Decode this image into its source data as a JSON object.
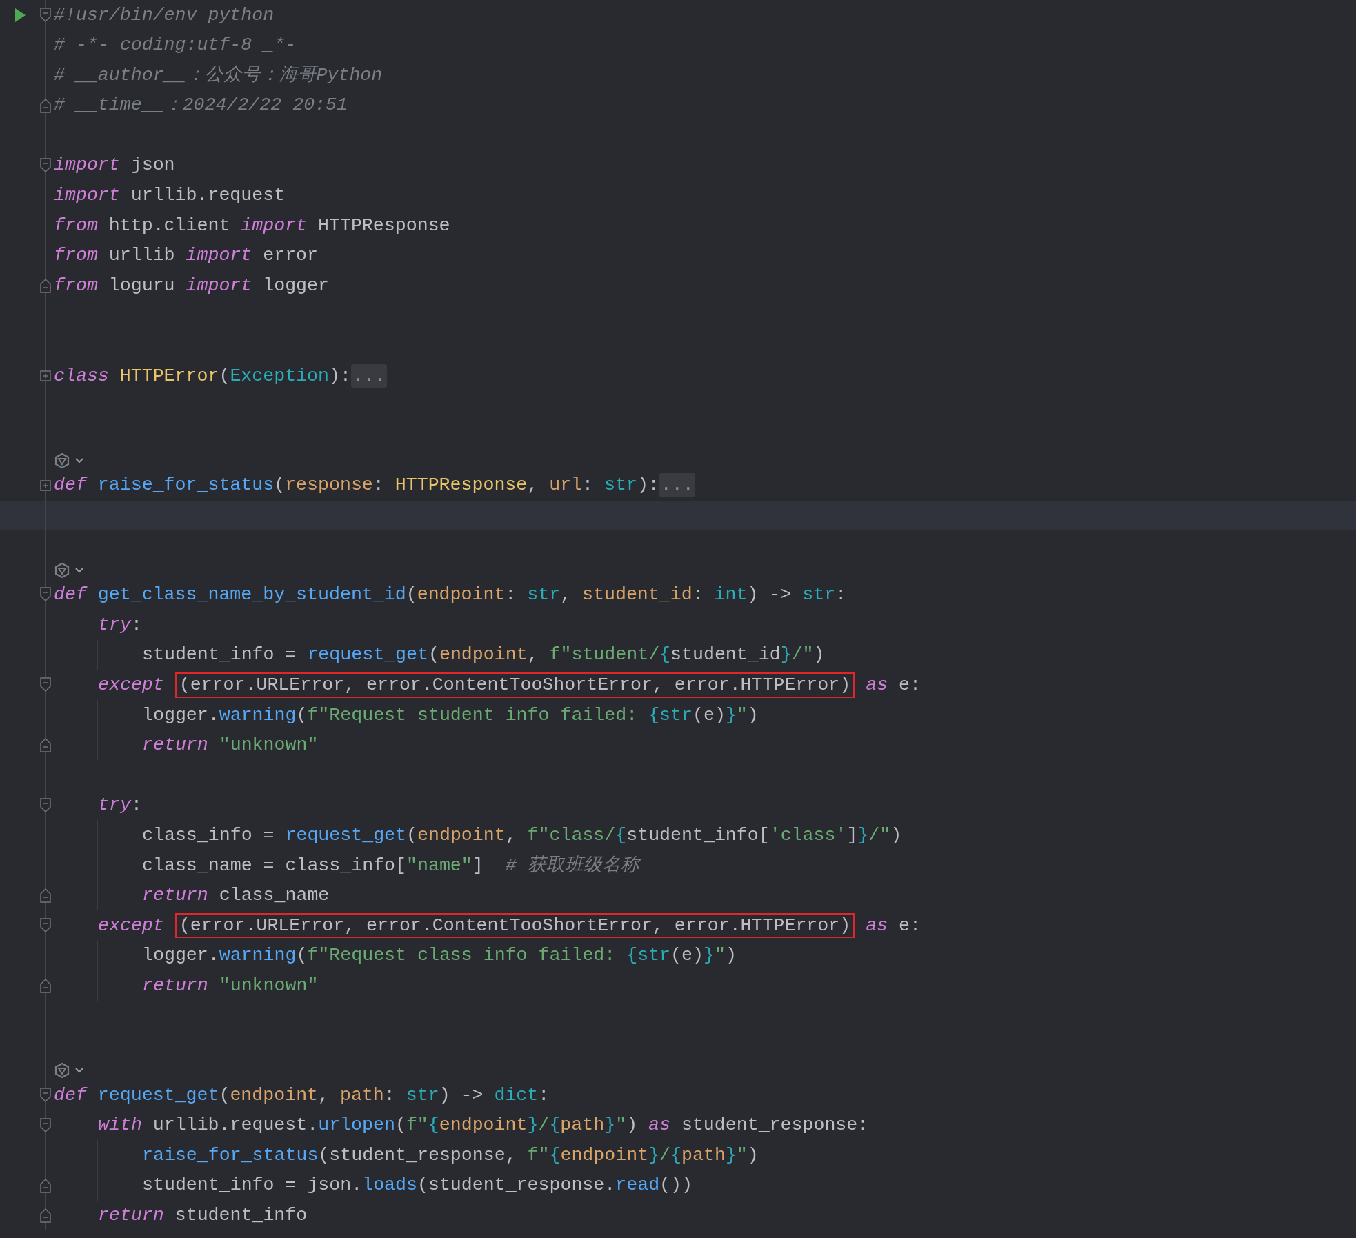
{
  "editor": {
    "lines": [
      {
        "kind": "code",
        "gutter_icon": {
          "kind": "run"
        },
        "fold_marker": {
          "kind": "start"
        },
        "tokens": [
          {
            "kind": "cmt",
            "text": "#!usr/bin/env python"
          }
        ]
      },
      {
        "kind": "code",
        "tokens": [
          {
            "kind": "cmt",
            "text": "# -*- coding:utf-8 _*-"
          }
        ]
      },
      {
        "kind": "code",
        "tokens": [
          {
            "kind": "cmt",
            "text": "# __author__：公众号：海哥Python"
          }
        ]
      },
      {
        "kind": "code",
        "fold_marker": {
          "kind": "end"
        },
        "tokens": [
          {
            "kind": "cmt",
            "text": "# __time__：2024/2/22 20:51"
          }
        ]
      },
      {
        "kind": "blank"
      },
      {
        "kind": "code",
        "fold_marker": {
          "kind": "start"
        },
        "tokens": [
          {
            "kind": "kw",
            "text": "import"
          },
          {
            "kind": "plain",
            "text": " json"
          }
        ]
      },
      {
        "kind": "code",
        "tokens": [
          {
            "kind": "kw",
            "text": "import"
          },
          {
            "kind": "plain",
            "text": " urllib.request"
          }
        ]
      },
      {
        "kind": "code",
        "tokens": [
          {
            "kind": "kw",
            "text": "from"
          },
          {
            "kind": "plain",
            "text": " http.client "
          },
          {
            "kind": "kw",
            "text": "import"
          },
          {
            "kind": "plain",
            "text": " HTTPResponse"
          }
        ]
      },
      {
        "kind": "code",
        "tokens": [
          {
            "kind": "kw",
            "text": "from"
          },
          {
            "kind": "plain",
            "text": " urllib "
          },
          {
            "kind": "kw",
            "text": "import"
          },
          {
            "kind": "plain",
            "text": " error"
          }
        ]
      },
      {
        "kind": "code",
        "fold_marker": {
          "kind": "end"
        },
        "tokens": [
          {
            "kind": "kw",
            "text": "from"
          },
          {
            "kind": "plain",
            "text": " loguru "
          },
          {
            "kind": "kw",
            "text": "import"
          },
          {
            "kind": "plain",
            "text": " logger"
          }
        ]
      },
      {
        "kind": "blank"
      },
      {
        "kind": "blank"
      },
      {
        "kind": "code",
        "fold_marker": {
          "kind": "collapsed"
        },
        "tokens": [
          {
            "kind": "kw",
            "text": "class "
          },
          {
            "kind": "type",
            "text": "HTTPError"
          },
          {
            "kind": "plain",
            "text": "("
          },
          {
            "kind": "builtin",
            "text": "Exception"
          },
          {
            "kind": "plain",
            "text": "):"
          },
          {
            "kind": "folded",
            "text": "..."
          }
        ]
      },
      {
        "kind": "blank"
      },
      {
        "kind": "blank"
      },
      {
        "kind": "inlay"
      },
      {
        "kind": "code",
        "fold_marker": {
          "kind": "collapsed"
        },
        "tokens": [
          {
            "kind": "kw",
            "text": "def "
          },
          {
            "kind": "fn",
            "text": "raise_for_status"
          },
          {
            "kind": "plain",
            "text": "("
          },
          {
            "kind": "param",
            "text": "response"
          },
          {
            "kind": "plain",
            "text": ": "
          },
          {
            "kind": "type",
            "text": "HTTPResponse"
          },
          {
            "kind": "plain",
            "text": ", "
          },
          {
            "kind": "param",
            "text": "url"
          },
          {
            "kind": "plain",
            "text": ": "
          },
          {
            "kind": "builtin",
            "text": "str"
          },
          {
            "kind": "plain",
            "text": "):"
          },
          {
            "kind": "folded",
            "text": "..."
          }
        ]
      },
      {
        "kind": "current"
      },
      {
        "kind": "blank"
      },
      {
        "kind": "inlay"
      },
      {
        "kind": "code",
        "fold_marker": {
          "kind": "start"
        },
        "tokens": [
          {
            "kind": "kw",
            "text": "def "
          },
          {
            "kind": "fn",
            "text": "get_class_name_by_student_id"
          },
          {
            "kind": "plain",
            "text": "("
          },
          {
            "kind": "param",
            "text": "endpoint"
          },
          {
            "kind": "plain",
            "text": ": "
          },
          {
            "kind": "builtin",
            "text": "str"
          },
          {
            "kind": "plain",
            "text": ", "
          },
          {
            "kind": "param",
            "text": "student_id"
          },
          {
            "kind": "plain",
            "text": ": "
          },
          {
            "kind": "builtin",
            "text": "int"
          },
          {
            "kind": "plain",
            "text": ") -> "
          },
          {
            "kind": "builtin",
            "text": "str"
          },
          {
            "kind": "plain",
            "text": ":"
          }
        ],
        "children": [
          {
            "kind": "code",
            "tokens": [
              {
                "kind": "kw",
                "text": "try"
              },
              {
                "kind": "plain",
                "text": ":"
              }
            ],
            "children": [
              {
                "kind": "code",
                "tokens": [
                  {
                    "kind": "plain",
                    "text": "student_info = "
                  },
                  {
                    "kind": "fn",
                    "text": "request_get"
                  },
                  {
                    "kind": "plain",
                    "text": "("
                  },
                  {
                    "kind": "param",
                    "text": "endpoint"
                  },
                  {
                    "kind": "plain",
                    "text": ", "
                  },
                  {
                    "kind": "str",
                    "text": "f\"student/"
                  },
                  {
                    "kind": "brace",
                    "text": "{"
                  },
                  {
                    "kind": "plain",
                    "text": "student_id"
                  },
                  {
                    "kind": "brace",
                    "text": "}"
                  },
                  {
                    "kind": "str",
                    "text": "/\""
                  },
                  {
                    "kind": "plain",
                    "text": ")"
                  }
                ]
              }
            ]
          },
          {
            "kind": "code",
            "fold_marker": {
              "kind": "start"
            },
            "tokens": [
              {
                "kind": "kw",
                "text": "except "
              },
              {
                "kind": "boxed",
                "text": "(error.URLError, error.ContentTooShortError, error.HTTPError)"
              },
              {
                "kind": "kw",
                "text": " as"
              },
              {
                "kind": "plain",
                "text": " e:"
              }
            ],
            "children": [
              {
                "kind": "code",
                "tokens": [
                  {
                    "kind": "plain",
                    "text": "logger."
                  },
                  {
                    "kind": "fn",
                    "text": "warning"
                  },
                  {
                    "kind": "plain",
                    "text": "("
                  },
                  {
                    "kind": "str",
                    "text": "f\"Request student info failed: "
                  },
                  {
                    "kind": "brace",
                    "text": "{"
                  },
                  {
                    "kind": "builtin",
                    "text": "str"
                  },
                  {
                    "kind": "plain",
                    "text": "(e)"
                  },
                  {
                    "kind": "brace",
                    "text": "}"
                  },
                  {
                    "kind": "str",
                    "text": "\""
                  },
                  {
                    "kind": "plain",
                    "text": ")"
                  }
                ]
              },
              {
                "kind": "code",
                "fold_marker": {
                  "kind": "end"
                },
                "tokens": [
                  {
                    "kind": "kw",
                    "text": "return "
                  },
                  {
                    "kind": "str",
                    "text": "\"unknown\""
                  }
                ]
              }
            ]
          },
          {
            "kind": "blank"
          },
          {
            "kind": "code",
            "fold_marker": {
              "kind": "start"
            },
            "tokens": [
              {
                "kind": "kw",
                "text": "try"
              },
              {
                "kind": "plain",
                "text": ":"
              }
            ],
            "children": [
              {
                "kind": "code",
                "tokens": [
                  {
                    "kind": "plain",
                    "text": "class_info = "
                  },
                  {
                    "kind": "fn",
                    "text": "request_get"
                  },
                  {
                    "kind": "plain",
                    "text": "("
                  },
                  {
                    "kind": "param",
                    "text": "endpoint"
                  },
                  {
                    "kind": "plain",
                    "text": ", "
                  },
                  {
                    "kind": "str",
                    "text": "f\"class/"
                  },
                  {
                    "kind": "brace",
                    "text": "{"
                  },
                  {
                    "kind": "plain",
                    "text": "student_info["
                  },
                  {
                    "kind": "str",
                    "text": "'class'"
                  },
                  {
                    "kind": "plain",
                    "text": "]"
                  },
                  {
                    "kind": "brace",
                    "text": "}"
                  },
                  {
                    "kind": "str",
                    "text": "/\""
                  },
                  {
                    "kind": "plain",
                    "text": ")"
                  }
                ]
              },
              {
                "kind": "code",
                "tokens": [
                  {
                    "kind": "plain",
                    "text": "class_name = class_info["
                  },
                  {
                    "kind": "str",
                    "text": "\"name\""
                  },
                  {
                    "kind": "plain",
                    "text": "]  "
                  },
                  {
                    "kind": "cmt",
                    "text": "# 获取班级名称"
                  }
                ]
              },
              {
                "kind": "code",
                "fold_marker": {
                  "kind": "end"
                },
                "tokens": [
                  {
                    "kind": "kw",
                    "text": "return"
                  },
                  {
                    "kind": "plain",
                    "text": " class_name"
                  }
                ]
              }
            ]
          },
          {
            "kind": "code",
            "fold_marker": {
              "kind": "start"
            },
            "tokens": [
              {
                "kind": "kw",
                "text": "except "
              },
              {
                "kind": "boxed",
                "text": "(error.URLError, error.ContentTooShortError, error.HTTPError)"
              },
              {
                "kind": "kw",
                "text": " as"
              },
              {
                "kind": "plain",
                "text": " e:"
              }
            ],
            "children": [
              {
                "kind": "code",
                "tokens": [
                  {
                    "kind": "plain",
                    "text": "logger."
                  },
                  {
                    "kind": "fn",
                    "text": "warning"
                  },
                  {
                    "kind": "plain",
                    "text": "("
                  },
                  {
                    "kind": "str",
                    "text": "f\"Request class info failed: "
                  },
                  {
                    "kind": "brace",
                    "text": "{"
                  },
                  {
                    "kind": "builtin",
                    "text": "str"
                  },
                  {
                    "kind": "plain",
                    "text": "(e)"
                  },
                  {
                    "kind": "brace",
                    "text": "}"
                  },
                  {
                    "kind": "str",
                    "text": "\""
                  },
                  {
                    "kind": "plain",
                    "text": ")"
                  }
                ]
              },
              {
                "kind": "code",
                "fold_marker": {
                  "kind": "end"
                },
                "tokens": [
                  {
                    "kind": "kw",
                    "text": "return "
                  },
                  {
                    "kind": "str",
                    "text": "\"unknown\""
                  }
                ]
              }
            ]
          }
        ]
      },
      {
        "kind": "blank"
      },
      {
        "kind": "blank"
      },
      {
        "kind": "inlay"
      },
      {
        "kind": "code",
        "fold_marker": {
          "kind": "start"
        },
        "tokens": [
          {
            "kind": "kw",
            "text": "def "
          },
          {
            "kind": "fn",
            "text": "request_get"
          },
          {
            "kind": "plain",
            "text": "("
          },
          {
            "kind": "param",
            "text": "endpoint"
          },
          {
            "kind": "plain",
            "text": ", "
          },
          {
            "kind": "param",
            "text": "path"
          },
          {
            "kind": "plain",
            "text": ": "
          },
          {
            "kind": "builtin",
            "text": "str"
          },
          {
            "kind": "plain",
            "text": ") -> "
          },
          {
            "kind": "builtin",
            "text": "dict"
          },
          {
            "kind": "plain",
            "text": ":"
          }
        ],
        "children": [
          {
            "kind": "code",
            "fold_marker": {
              "kind": "start"
            },
            "tokens": [
              {
                "kind": "kw",
                "text": "with"
              },
              {
                "kind": "plain",
                "text": " urllib.request."
              },
              {
                "kind": "fn",
                "text": "urlopen"
              },
              {
                "kind": "plain",
                "text": "("
              },
              {
                "kind": "str",
                "text": "f\""
              },
              {
                "kind": "brace",
                "text": "{"
              },
              {
                "kind": "param",
                "text": "endpoint"
              },
              {
                "kind": "brace",
                "text": "}"
              },
              {
                "kind": "str",
                "text": "/"
              },
              {
                "kind": "brace",
                "text": "{"
              },
              {
                "kind": "param",
                "text": "path"
              },
              {
                "kind": "brace",
                "text": "}"
              },
              {
                "kind": "str",
                "text": "\""
              },
              {
                "kind": "plain",
                "text": ") "
              },
              {
                "kind": "kw",
                "text": "as"
              },
              {
                "kind": "plain",
                "text": " student_response:"
              }
            ],
            "children": [
              {
                "kind": "code",
                "tokens": [
                  {
                    "kind": "fn",
                    "text": "raise_for_status"
                  },
                  {
                    "kind": "plain",
                    "text": "(student_response, "
                  },
                  {
                    "kind": "str",
                    "text": "f\""
                  },
                  {
                    "kind": "brace",
                    "text": "{"
                  },
                  {
                    "kind": "param",
                    "text": "endpoint"
                  },
                  {
                    "kind": "brace",
                    "text": "}"
                  },
                  {
                    "kind": "str",
                    "text": "/"
                  },
                  {
                    "kind": "brace",
                    "text": "{"
                  },
                  {
                    "kind": "param",
                    "text": "path"
                  },
                  {
                    "kind": "brace",
                    "text": "}"
                  },
                  {
                    "kind": "str",
                    "text": "\""
                  },
                  {
                    "kind": "plain",
                    "text": ")"
                  }
                ]
              },
              {
                "kind": "code",
                "fold_marker": {
                  "kind": "end"
                },
                "tokens": [
                  {
                    "kind": "plain",
                    "text": "student_info = json."
                  },
                  {
                    "kind": "fn",
                    "text": "loads"
                  },
                  {
                    "kind": "plain",
                    "text": "(student_response."
                  },
                  {
                    "kind": "fn",
                    "text": "read"
                  },
                  {
                    "kind": "plain",
                    "text": "())"
                  }
                ]
              }
            ]
          },
          {
            "kind": "code",
            "fold_marker": {
              "kind": "end"
            },
            "tokens": [
              {
                "kind": "kw",
                "text": "return"
              },
              {
                "kind": "plain",
                "text": " student_info"
              }
            ]
          }
        ]
      }
    ]
  }
}
